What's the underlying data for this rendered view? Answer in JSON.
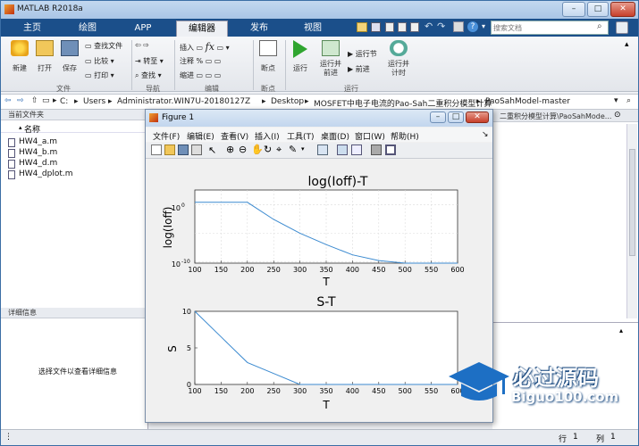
{
  "app": {
    "title": "MATLAB R2018a"
  },
  "tabs": [
    {
      "label": "主页"
    },
    {
      "label": "绘图"
    },
    {
      "label": "APP"
    },
    {
      "label": "编辑器"
    },
    {
      "label": "发布"
    },
    {
      "label": "视图"
    }
  ],
  "search": {
    "placeholder": "搜索文档"
  },
  "ribbon": {
    "file": {
      "new": "新建",
      "open": "打开",
      "save": "保存",
      "find_files": "查找文件",
      "compare": "比较",
      "print": "打印",
      "group": "文件"
    },
    "nav": {
      "goto": "转至",
      "find": "查找",
      "group": "导航"
    },
    "edit": {
      "insert": "插入",
      "comment": "注释",
      "indent": "缩进",
      "fx": "fx",
      "group": "编辑"
    },
    "breakpoint": {
      "label": "断点",
      "group": "断点"
    },
    "run": {
      "run": "运行",
      "run_advance": "运行并\n前进",
      "run_section": "运行节",
      "advance": "前进",
      "run_time": "运行并\n计时",
      "group": "运行"
    }
  },
  "address": {
    "path": [
      "C:",
      "Users",
      "Administrator.WIN7U-20180127Z",
      "Desktop",
      "MOSFET中电子电流的Pao-Sah二重积分模型计算",
      "PaoSahModel-master"
    ],
    "right_path": "二重积分模型计算\\PaoSahMode..."
  },
  "current_folder": {
    "title": "当前文件夹",
    "col_name": "名称",
    "files": [
      {
        "name": "HW4_a.m"
      },
      {
        "name": "HW4_b.m"
      },
      {
        "name": "HW4_d.m"
      },
      {
        "name": "HW4_dplot.m"
      }
    ]
  },
  "details": {
    "title": "详细信息",
    "hint": "选择文件以查看详细信息"
  },
  "status": {
    "row_label": "行",
    "row_val": "1",
    "col_label": "列",
    "col_val": "1"
  },
  "figure": {
    "title": "Figure 1",
    "menu": [
      "文件(F)",
      "编辑(E)",
      "查看(V)",
      "插入(I)",
      "工具(T)",
      "桌面(D)",
      "窗口(W)",
      "帮助(H)"
    ]
  },
  "chart_data": [
    {
      "type": "line",
      "title": "log(Ioff)-T",
      "xlabel": "T",
      "ylabel": "log(Ioff)",
      "xlim": [
        100,
        600
      ],
      "y_scale": "log",
      "ylim_exp": [
        -10,
        0
      ],
      "x_ticks": [
        "100",
        "150",
        "200",
        "250",
        "300",
        "350",
        "400",
        "450",
        "500",
        "550",
        "600"
      ],
      "y_ticks": [
        {
          "base": "10",
          "exp": "0"
        },
        {
          "base": "10",
          "exp": "-10"
        }
      ],
      "grid": true,
      "x": [
        100,
        150,
        200,
        250,
        300,
        350,
        400,
        450,
        500,
        550,
        600
      ],
      "y_exp": [
        0.4,
        0.4,
        0.4,
        -2.6,
        -5.0,
        -7.0,
        -8.8,
        -9.8,
        -10.6,
        -11.2,
        -11.8
      ],
      "color": "#3b8ad0"
    },
    {
      "type": "line",
      "title": "S-T",
      "xlabel": "T",
      "ylabel": "S",
      "xlim": [
        100,
        600
      ],
      "ylim": [
        0,
        10
      ],
      "x_ticks": [
        "100",
        "150",
        "200",
        "250",
        "300",
        "350",
        "400",
        "450",
        "500",
        "550",
        "600"
      ],
      "y_ticks": [
        "0",
        "5",
        "10"
      ],
      "grid": false,
      "x": [
        100,
        150,
        200,
        250,
        300,
        350,
        400,
        450,
        500,
        550,
        600
      ],
      "y": [
        10,
        6.5,
        3.0,
        1.5,
        0,
        0,
        0,
        0,
        0,
        0,
        0
      ],
      "color": "#3b8ad0"
    }
  ],
  "watermark": {
    "brand": "必过源码",
    "site": "Biguo100.com"
  }
}
